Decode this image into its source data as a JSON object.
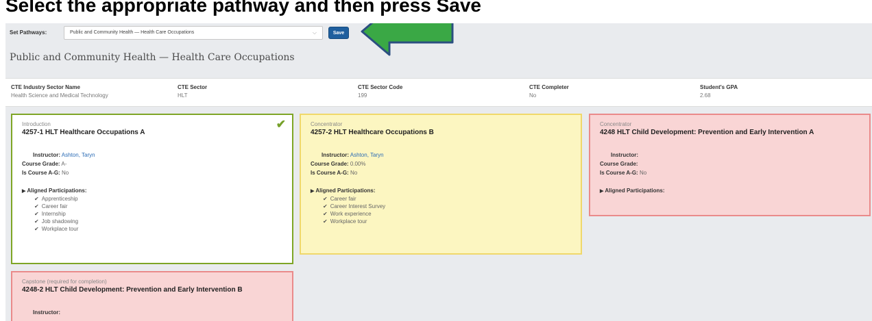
{
  "heading": "Select the appropriate pathway and then press Save",
  "pathway": {
    "label": "Set Pathways:",
    "selected": "Public and Community Health — Health Care Occupations",
    "save_label": "Save"
  },
  "page_title": "Public and Community Health — Health Care Occupations",
  "sector": {
    "industry": {
      "label": "CTE Industry Sector Name",
      "value": "Health Science and Medical Technology"
    },
    "sector": {
      "label": "CTE Sector",
      "value": "HLT"
    },
    "code": {
      "label": "CTE Sector Code",
      "value": "199"
    },
    "completer": {
      "label": "CTE Completer",
      "value": "No"
    },
    "gpa": {
      "label": "Student's GPA",
      "value": "2.68"
    }
  },
  "labels": {
    "instructor": "Instructor:",
    "grade": "Course Grade:",
    "ag": "Is Course A-G:",
    "aligned": "Aligned Participations:"
  },
  "cards": [
    {
      "stage": "Introduction",
      "course": "4257-1 HLT Healthcare Occupations A",
      "instructor": "Ashton, Taryn",
      "grade": "A-",
      "ag": "No",
      "participations": [
        "Apprenticeship",
        "Career fair",
        "Internship",
        "Job shadowing",
        "Workplace tour"
      ],
      "status_color": "#7ea525"
    },
    {
      "stage": "Concentrator",
      "course": "4257-2 HLT Healthcare Occupations B",
      "instructor": "Ashton, Taryn",
      "grade": "0.00%",
      "ag": "No",
      "participations": [
        "Career fair",
        "Career Interest Survey",
        "Work experience",
        "Workplace tour"
      ],
      "status_color": "#f0d86a"
    },
    {
      "stage": "Concentrator",
      "course": "4248 HLT Child Development: Prevention and Early Intervention A",
      "instructor": "",
      "grade": "",
      "ag": "No",
      "participations": [],
      "status_color": "#ea8a8a"
    },
    {
      "stage": "Capstone (required for completion)",
      "course": "4248-2 HLT Child Development: Prevention and Early Intervention B",
      "instructor": "",
      "status_color": "#ea8a8a"
    }
  ],
  "icons": {
    "check": "check-icon",
    "arrow": "green-arrow-icon",
    "caret": "caret-down-icon"
  },
  "colors": {
    "save_button": "#1f5f9e",
    "arrow": "#3aa845",
    "link": "#2a6bb5"
  }
}
